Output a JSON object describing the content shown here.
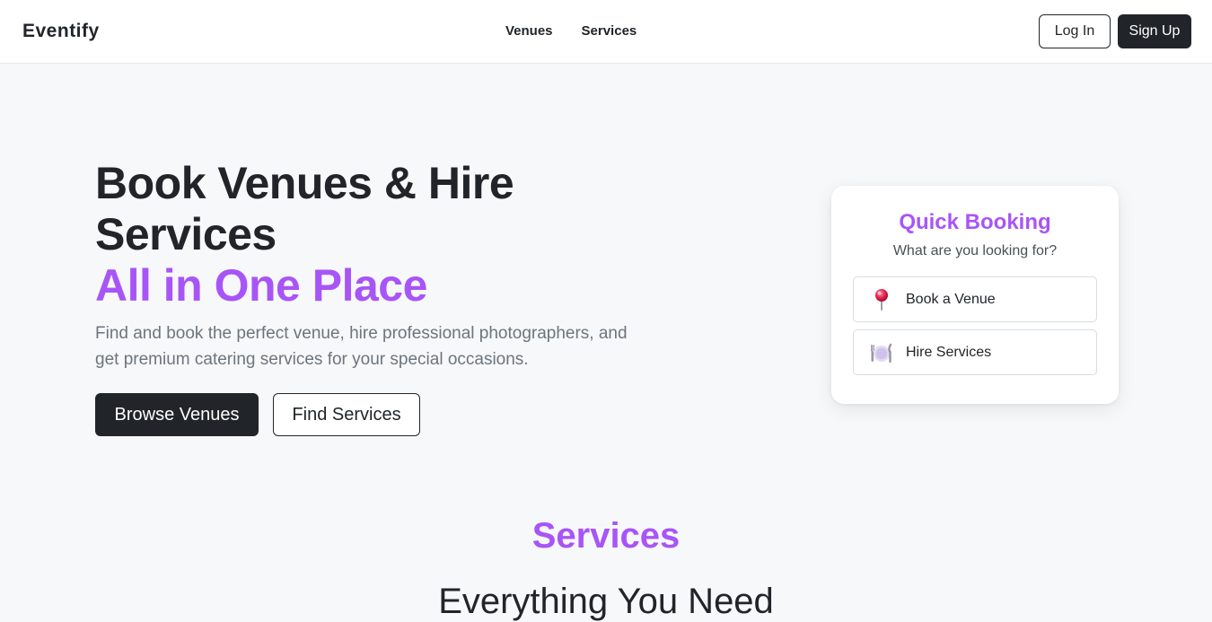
{
  "nav": {
    "brand": "Eventify",
    "links": [
      "Venues",
      "Services"
    ],
    "login_label": "Log In",
    "signup_label": "Sign Up"
  },
  "hero": {
    "title_line1": "Book Venues & Hire Services",
    "title_accent": "All in One Place",
    "description": "Find and book the perfect venue, hire professional photographers, and get premium catering services for your special occasions.",
    "primary_button": "Browse Venues",
    "secondary_button": "Find Services"
  },
  "quick_booking": {
    "title": "Quick Booking",
    "subtitle": "What are you looking for?",
    "options": [
      {
        "label": "Book a Venue",
        "icon": "pin-icon"
      },
      {
        "label": "Hire Services",
        "icon": "plate-cutlery-icon"
      }
    ]
  },
  "section": {
    "label": "Services",
    "heading": "Everything You Need"
  },
  "colors": {
    "accent": "#a855f7",
    "dark": "#212529",
    "muted": "#6c757d",
    "background": "#f7f8f9"
  }
}
